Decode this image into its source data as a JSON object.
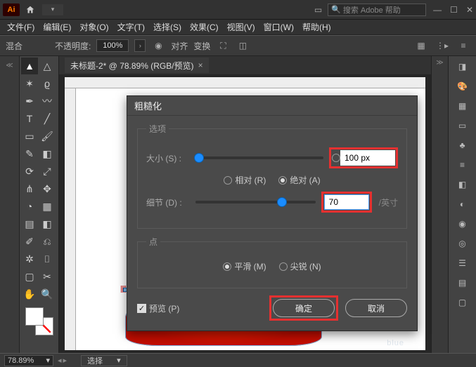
{
  "app": {
    "search_placeholder": "搜索 Adobe 帮助"
  },
  "menu": {
    "file": "文件(F)",
    "edit": "编辑(E)",
    "object": "对象(O)",
    "type": "文字(T)",
    "select": "选择(S)",
    "effect": "效果(C)",
    "view": "视图(V)",
    "window": "窗口(W)",
    "help": "帮助(H)"
  },
  "options_bar": {
    "blend_label": "混合",
    "opacity_label": "不透明度:",
    "opacity_value": "100%",
    "align_label": "对齐",
    "transform_label": "变换"
  },
  "doc": {
    "tab_title": "未标题-2* @ 78.89% (RGB/预览)"
  },
  "dialog": {
    "title": "粗糙化",
    "options_legend": "选项",
    "size_label": "大小 (S) :",
    "size_value": "100 px",
    "relative_label": "相对 (R)",
    "absolute_label": "绝对 (A)",
    "detail_label": "细节 (D) :",
    "detail_value": "70",
    "detail_unit": "/英寸",
    "points_legend": "点",
    "smooth_label": "平滑 (M)",
    "corner_label": "尖锐 (N)",
    "preview_label": "预览 (P)",
    "ok": "确定",
    "cancel": "取消"
  },
  "status": {
    "zoom": "78.89%",
    "tool": "选择"
  },
  "watermark": "blue"
}
